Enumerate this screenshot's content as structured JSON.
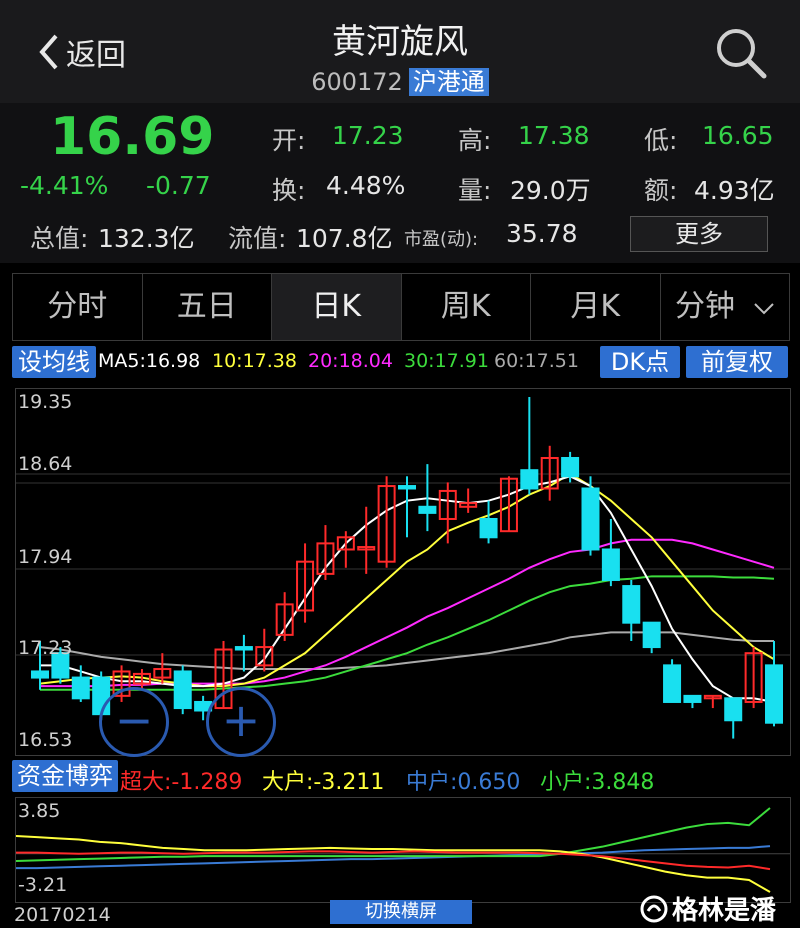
{
  "header": {
    "back_label": "返回",
    "title": "黄河旋风",
    "code": "600172",
    "badge": "沪港通"
  },
  "quote": {
    "price": "16.69",
    "pct": "-4.41%",
    "chg": "-0.77",
    "open_label": "开:",
    "open": "17.23",
    "high_label": "高:",
    "high": "17.38",
    "low_label": "低:",
    "low": "16.65",
    "turnover_label": "换:",
    "turnover": "4.48%",
    "volume_label": "量:",
    "volume": "29.0万",
    "amount_label": "额:",
    "amount": "4.93亿",
    "mcap_label": "总值:",
    "mcap": "132.3亿",
    "float_label": "流值:",
    "float": "107.8亿",
    "pe_label": "市盈(动):",
    "pe": "35.78",
    "more_label": "更多"
  },
  "tabs": [
    "分时",
    "五日",
    "日K",
    "周K",
    "月K",
    "分钟"
  ],
  "active_tab": 2,
  "indicators": {
    "set_label": "设均线",
    "ma5": "MA5:16.98",
    "ma10": "10:17.38",
    "ma20": "20:18.04",
    "ma30": "30:17.91",
    "ma60": "60:17.51",
    "dk_label": "DK点",
    "fq_label": "前复权"
  },
  "chart_axis": {
    "y_top": "19.35",
    "y_2": "18.64",
    "y_3": "17.94",
    "y_4": "17.23",
    "y_bottom": "16.53"
  },
  "fund": {
    "label": "资金博弈",
    "super": "超大:-1.289",
    "large": "大户:-3.211",
    "mid": "中户:0.650",
    "small": "小户:3.848",
    "y_top": "3.85",
    "y_bottom": "-3.21"
  },
  "date_label": "20170214",
  "switch_label": "切换横屏",
  "watermark": "格林是潘",
  "colors": {
    "up": "#ff2a2a",
    "down": "#19e0f0",
    "ma5": "#ffffff",
    "ma10": "#ffff3c",
    "ma20": "#ff2aff",
    "ma30": "#3cdc3c",
    "ma60": "#aaaaaa"
  },
  "chart_data": {
    "type": "candlestick",
    "ylim": [
      16.53,
      19.35
    ],
    "candles": [
      {
        "o": 17.1,
        "c": 17.05,
        "h": 17.35,
        "l": 16.95
      },
      {
        "o": 17.25,
        "c": 17.05,
        "h": 17.3,
        "l": 17.0
      },
      {
        "o": 17.05,
        "c": 16.88,
        "h": 17.15,
        "l": 16.85
      },
      {
        "o": 17.05,
        "c": 16.75,
        "h": 17.1,
        "l": 16.7
      },
      {
        "o": 16.9,
        "c": 17.1,
        "h": 17.15,
        "l": 16.85
      },
      {
        "o": 17.0,
        "c": 17.08,
        "h": 17.12,
        "l": 16.95
      },
      {
        "o": 17.05,
        "c": 17.12,
        "h": 17.25,
        "l": 17.0
      },
      {
        "o": 17.1,
        "c": 16.8,
        "h": 17.15,
        "l": 16.75
      },
      {
        "o": 16.85,
        "c": 16.78,
        "h": 16.9,
        "l": 16.7
      },
      {
        "o": 16.8,
        "c": 17.28,
        "h": 17.35,
        "l": 16.8
      },
      {
        "o": 17.3,
        "c": 17.28,
        "h": 17.4,
        "l": 17.1
      },
      {
        "o": 17.15,
        "c": 17.3,
        "h": 17.45,
        "l": 17.1
      },
      {
        "o": 17.4,
        "c": 17.65,
        "h": 17.75,
        "l": 17.35
      },
      {
        "o": 17.6,
        "c": 18.0,
        "h": 18.15,
        "l": 17.5
      },
      {
        "o": 17.9,
        "c": 18.15,
        "h": 18.3,
        "l": 17.85
      },
      {
        "o": 18.1,
        "c": 18.2,
        "h": 18.25,
        "l": 17.95
      },
      {
        "o": 18.1,
        "c": 18.12,
        "h": 18.45,
        "l": 17.9
      },
      {
        "o": 18.0,
        "c": 18.62,
        "h": 18.7,
        "l": 17.95
      },
      {
        "o": 18.62,
        "c": 18.6,
        "h": 18.7,
        "l": 18.2
      },
      {
        "o": 18.45,
        "c": 18.4,
        "h": 18.8,
        "l": 18.25
      },
      {
        "o": 18.35,
        "c": 18.58,
        "h": 18.65,
        "l": 18.15
      },
      {
        "o": 18.45,
        "c": 18.48,
        "h": 18.6,
        "l": 18.4
      },
      {
        "o": 18.35,
        "c": 18.2,
        "h": 18.5,
        "l": 18.15
      },
      {
        "o": 18.25,
        "c": 18.68,
        "h": 18.7,
        "l": 18.25
      },
      {
        "o": 18.75,
        "c": 18.6,
        "h": 19.35,
        "l": 18.55
      },
      {
        "o": 18.6,
        "c": 18.85,
        "h": 18.95,
        "l": 18.5
      },
      {
        "o": 18.85,
        "c": 18.7,
        "h": 18.9,
        "l": 18.65
      },
      {
        "o": 18.6,
        "c": 18.1,
        "h": 18.7,
        "l": 18.05
      },
      {
        "o": 18.1,
        "c": 17.85,
        "h": 18.35,
        "l": 17.8
      },
      {
        "o": 17.8,
        "c": 17.5,
        "h": 17.85,
        "l": 17.35
      },
      {
        "o": 17.5,
        "c": 17.3,
        "h": 17.5,
        "l": 17.25
      },
      {
        "o": 17.15,
        "c": 16.85,
        "h": 17.2,
        "l": 16.85
      },
      {
        "o": 16.9,
        "c": 16.85,
        "h": 16.9,
        "l": 16.8
      },
      {
        "o": 16.88,
        "c": 16.9,
        "h": 16.9,
        "l": 16.8
      },
      {
        "o": 16.88,
        "c": 16.7,
        "h": 16.88,
        "l": 16.55
      },
      {
        "o": 16.85,
        "c": 17.25,
        "h": 17.3,
        "l": 16.8
      },
      {
        "o": 17.15,
        "c": 16.68,
        "h": 17.35,
        "l": 16.65
      }
    ],
    "ma5": [
      17.15,
      17.15,
      17.1,
      17.05,
      17.02,
      17.02,
      17.0,
      16.98,
      16.98,
      17.0,
      17.05,
      17.2,
      17.45,
      17.7,
      17.95,
      18.15,
      18.3,
      18.42,
      18.5,
      18.52,
      18.5,
      18.48,
      18.5,
      18.55,
      18.62,
      18.65,
      18.7,
      18.62,
      18.4,
      18.1,
      17.8,
      17.45,
      17.2,
      16.98,
      16.88,
      16.88,
      16.85
    ],
    "ma10": [
      17.0,
      17.02,
      17.04,
      17.05,
      17.06,
      17.05,
      17.02,
      17.0,
      16.98,
      16.98,
      17.0,
      17.05,
      17.15,
      17.25,
      17.4,
      17.55,
      17.7,
      17.85,
      18.0,
      18.1,
      18.25,
      18.32,
      18.38,
      18.45,
      18.55,
      18.62,
      18.72,
      18.62,
      18.5,
      18.35,
      18.2,
      18.0,
      17.8,
      17.6,
      17.45,
      17.3,
      17.2
    ],
    "ma20": [
      16.98,
      16.98,
      16.98,
      16.98,
      16.99,
      16.99,
      17.0,
      17.0,
      17.0,
      17.0,
      17.0,
      17.02,
      17.05,
      17.1,
      17.15,
      17.22,
      17.3,
      17.38,
      17.46,
      17.55,
      17.62,
      17.7,
      17.78,
      17.86,
      17.95,
      18.02,
      18.08,
      18.1,
      18.15,
      18.18,
      18.18,
      18.18,
      18.15,
      18.1,
      18.05,
      18.0,
      17.95
    ],
    "ma30": [
      16.95,
      16.95,
      16.95,
      16.95,
      16.95,
      16.95,
      16.95,
      16.95,
      16.95,
      16.96,
      16.97,
      16.98,
      17.0,
      17.02,
      17.05,
      17.1,
      17.15,
      17.2,
      17.25,
      17.32,
      17.38,
      17.45,
      17.52,
      17.6,
      17.68,
      17.75,
      17.8,
      17.82,
      17.85,
      17.86,
      17.88,
      17.88,
      17.88,
      17.88,
      17.87,
      17.87,
      17.86
    ],
    "ma60": [
      17.3,
      17.28,
      17.25,
      17.22,
      17.2,
      17.18,
      17.16,
      17.15,
      17.14,
      17.13,
      17.12,
      17.12,
      17.12,
      17.12,
      17.12,
      17.13,
      17.14,
      17.15,
      17.17,
      17.19,
      17.21,
      17.23,
      17.25,
      17.28,
      17.31,
      17.34,
      17.38,
      17.4,
      17.42,
      17.42,
      17.42,
      17.42,
      17.4,
      17.38,
      17.36,
      17.35,
      17.35
    ],
    "fund_ylim": [
      -3.21,
      3.85
    ],
    "fund": {
      "super": [
        0.1,
        0.1,
        0.05,
        0.0,
        0.05,
        0.1,
        0.1,
        0.05,
        0.0,
        0.05,
        0.1,
        0.1,
        0.1,
        0.15,
        0.2,
        0.2,
        0.15,
        0.1,
        0.15,
        0.2,
        0.15,
        0.1,
        0.1,
        0.1,
        0.1,
        0.05,
        0.0,
        -0.1,
        -0.2,
        -0.4,
        -0.6,
        -0.8,
        -1.0,
        -1.1,
        -1.15,
        -1.0,
        -1.289
      ],
      "large": [
        1.5,
        1.4,
        1.3,
        1.2,
        1.0,
        0.9,
        0.7,
        0.5,
        0.4,
        0.3,
        0.3,
        0.3,
        0.35,
        0.4,
        0.45,
        0.5,
        0.45,
        0.4,
        0.4,
        0.35,
        0.3,
        0.3,
        0.3,
        0.3,
        0.3,
        0.3,
        0.2,
        0.0,
        -0.3,
        -0.7,
        -1.1,
        -1.5,
        -1.8,
        -2.0,
        -2.0,
        -2.2,
        -3.211
      ],
      "mid": [
        -1.2,
        -1.2,
        -1.15,
        -1.1,
        -1.05,
        -1.0,
        -0.95,
        -0.9,
        -0.85,
        -0.8,
        -0.75,
        -0.7,
        -0.65,
        -0.6,
        -0.55,
        -0.5,
        -0.45,
        -0.45,
        -0.4,
        -0.35,
        -0.3,
        -0.25,
        -0.2,
        -0.15,
        -0.1,
        -0.05,
        0.0,
        0.05,
        0.1,
        0.2,
        0.3,
        0.35,
        0.4,
        0.45,
        0.5,
        0.5,
        0.65
      ],
      "small": [
        -0.6,
        -0.55,
        -0.5,
        -0.45,
        -0.4,
        -0.35,
        -0.3,
        -0.25,
        -0.25,
        -0.2,
        -0.2,
        -0.2,
        -0.2,
        -0.2,
        -0.2,
        -0.2,
        -0.2,
        -0.2,
        -0.2,
        -0.2,
        -0.2,
        -0.2,
        -0.2,
        -0.2,
        -0.2,
        -0.2,
        0.0,
        0.3,
        0.6,
        1.0,
        1.4,
        1.8,
        2.2,
        2.5,
        2.6,
        2.4,
        3.848
      ]
    }
  }
}
